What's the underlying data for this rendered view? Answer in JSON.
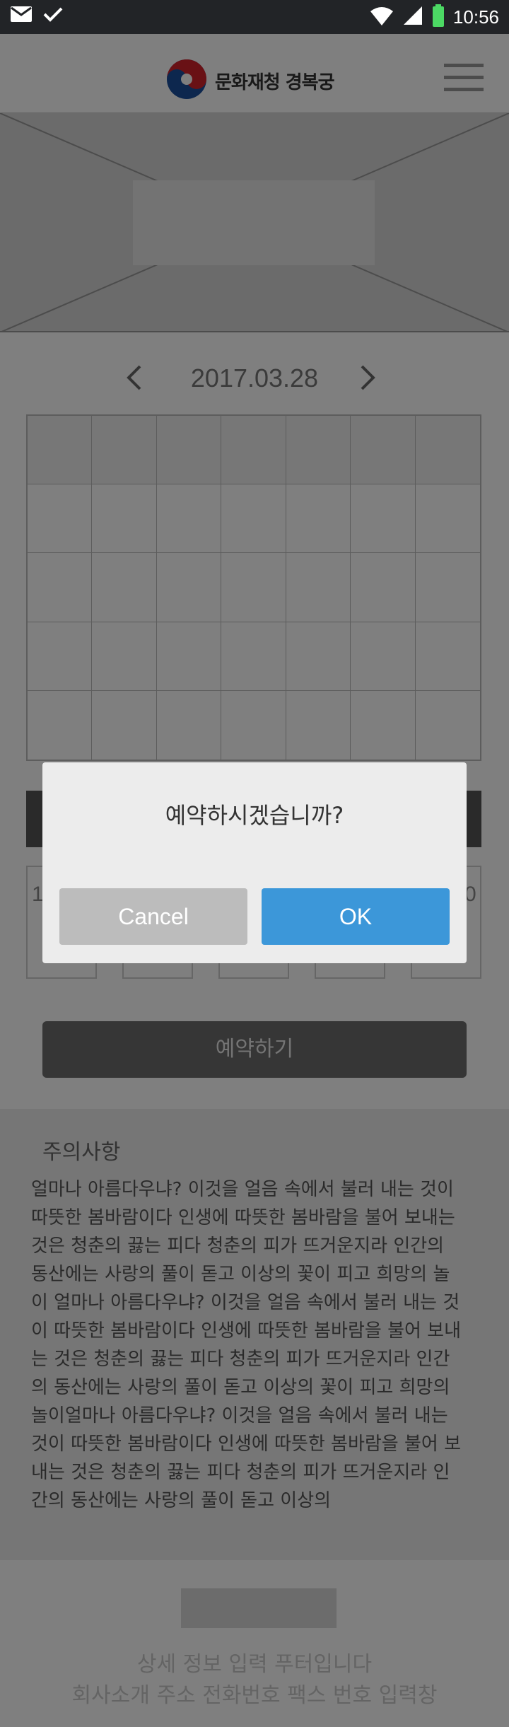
{
  "status_bar": {
    "time": "10:56",
    "icons": [
      "mail-icon",
      "check-icon",
      "wifi-icon",
      "signal-icon",
      "battery-icon"
    ],
    "battery_color": "#4cd964"
  },
  "header": {
    "logo_text": "문화재청 경복궁",
    "menu_icon": "hamburger-menu-icon"
  },
  "date_nav": {
    "date": "2017.03.28",
    "prev_icon": "chevron-left-icon",
    "next_icon": "chevron-right-icon"
  },
  "time_slots": {
    "first_label": "1",
    "last_label": "0"
  },
  "reserve_button": {
    "label": "예약하기"
  },
  "notice": {
    "title": "주의사항",
    "body_lines": [
      "얼마나 아름다우냐? 이것을 얼음 속에서 불러 내는 것이",
      "따뜻한 봄바람이다 인생에 따뜻한 봄바람을 불어 보내는",
      "것은 청춘의 끓는 피다 청춘의 피가 뜨거운지라 인간의",
      "동산에는 사랑의 풀이 돋고 이상의 꽃이 피고 희망의 놀",
      "이 얼마나 아름다우냐? 이것을 얼음 속에서 불러 내는 것",
      "이 따뜻한 봄바람이다 인생에 따뜻한 봄바람을 불어 보내",
      "는 것은 청춘의 끓는 피다 청춘의 피가 뜨거운지라 인간",
      "의 동산에는 사랑의 풀이 돋고 이상의 꽃이 피고 희망의",
      "놀이얼마나 아름다우냐? 이것을 얼음 속에서 불러 내는",
      "것이 따뜻한 봄바람이다 인생에 따뜻한 봄바람을 불어 보",
      "내는 것은 청춘의 끓는 피다 청춘의 피가 뜨거운지라 인",
      "간의 동산에는 사랑의 풀이 돋고 이상의"
    ]
  },
  "footer": {
    "line1": "상세 정보 입력 푸터입니다",
    "line2": "회사소개 주소 전화번호 팩스 번호 입력창"
  },
  "dialog": {
    "message": "예약하시겠습니까?",
    "cancel_label": "Cancel",
    "ok_label": "OK",
    "ok_color": "#3c97d9",
    "cancel_color": "#bcbcbc"
  }
}
